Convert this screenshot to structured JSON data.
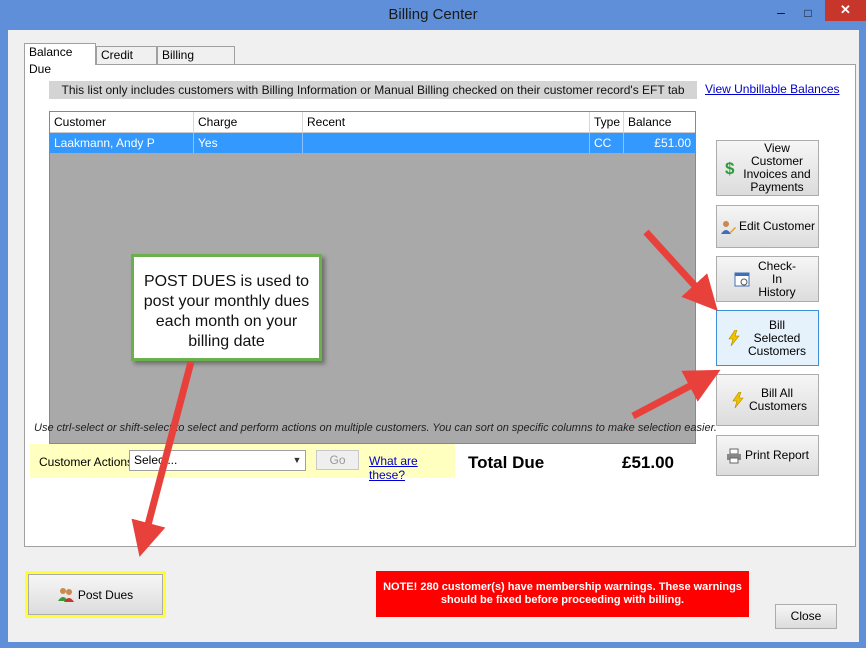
{
  "window": {
    "title": "Billing Center",
    "minimize_glyph": "–",
    "maximize_glyph": "□",
    "close_glyph": "✕"
  },
  "tabs": [
    {
      "label": "Balance Due",
      "active": true
    },
    {
      "label": "Credit Due",
      "active": false
    },
    {
      "label": "Billing Events",
      "active": false
    }
  ],
  "notice": "This list only includes customers with Billing Information or Manual Billing checked on their customer record's EFT tab",
  "view_unbillable_link": "View Unbillable Balances",
  "grid": {
    "columns": [
      "Customer",
      "Charge",
      "Recent",
      "Type",
      "Balance"
    ],
    "rows": [
      {
        "customer": "Laakmann, Andy P",
        "charge": "Yes",
        "recent": "",
        "type": "CC",
        "balance": "£51.00",
        "selected": true
      }
    ]
  },
  "side_buttons": {
    "view_invoices": {
      "label": "View Customer Invoices and Payments",
      "icon": "dollar-icon"
    },
    "edit_customer": {
      "label": "Edit Customer",
      "icon": "user-edit-icon"
    },
    "checkin_history": {
      "label": "Check-In History",
      "icon": "calendar-icon"
    },
    "bill_selected": {
      "label": "Bill Selected Customers",
      "icon": "lightning-icon"
    },
    "bill_all": {
      "label": "Bill All Customers",
      "icon": "lightning-icon"
    },
    "print_report": {
      "label": "Print Report",
      "icon": "printer-icon"
    }
  },
  "hint": "Use ctrl-select or shift-select to select and perform actions on multiple customers.  You can sort on specific columns to make selection easier.",
  "customer_actions": {
    "label": "Customer Actions",
    "select_value": "Select...",
    "go_label": "Go",
    "help_link": "What are these?"
  },
  "total": {
    "label": "Total Due",
    "value": "£51.00"
  },
  "post_dues": {
    "label": "Post Dues",
    "icon": "users-icon"
  },
  "warning": "NOTE! 280 customer(s) have membership warnings.   These warnings should be fixed before proceeding with billing.",
  "close_label": "Close",
  "callout": "POST DUES is used to post your monthly dues each month on your billing date",
  "colors": {
    "titlebar": "#5f8fd8",
    "selection": "#3399ff",
    "warning_bg": "#ff0000",
    "highlight_yellow": "#ffff33",
    "arrow_red": "#e8413c",
    "callout_border": "#6ab04c"
  }
}
